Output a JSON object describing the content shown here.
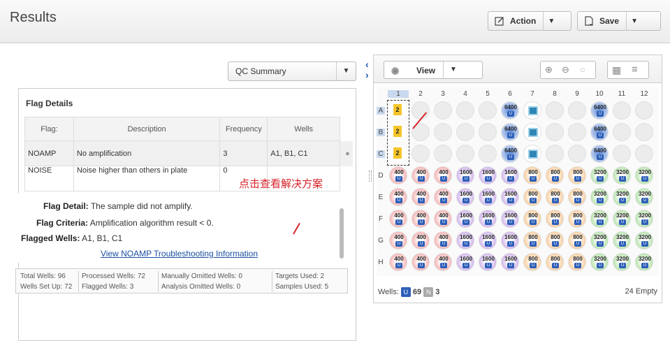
{
  "header": {
    "title": "Results",
    "action_label": "Action",
    "save_label": "Save"
  },
  "left": {
    "qc_select": "QC Summary",
    "flag_details_title": "Flag Details",
    "table": {
      "headers": [
        "Flag:",
        "Description",
        "Frequency",
        "Wells"
      ],
      "rows": [
        [
          "NOAMP",
          "No amplification",
          "3",
          "A1, B1, C1"
        ],
        [
          "NOISE",
          "Noise higher than others in plate",
          "0",
          ""
        ]
      ]
    },
    "detail": {
      "flag_detail_label": "Flag Detail:",
      "flag_detail_value": "The sample did not amplify.",
      "flag_criteria_label": "Flag Criteria:",
      "flag_criteria_value": "Amplification algorithm result < 0.",
      "flagged_wells_label": "Flagged Wells:",
      "flagged_wells_value": "A1, B1, C1",
      "link": "View NOAMP Troubleshooting Information"
    },
    "annotation": "点击查看解决方案",
    "stats": {
      "total_wells": "Total Wells:  96",
      "wells_set_up": "Wells Set Up: 72",
      "processed_wells": "Processed Wells: 72",
      "flagged_wells": "Flagged Wells:     3",
      "manually_omitted": "Manually Omitted Wells: 0",
      "analysis_omitted": "Analysis Omitted Wells: 0",
      "targets_used": "Targets Used:  2",
      "samples_used": "Samples Used: 5"
    }
  },
  "right": {
    "view_label": "View",
    "columns": [
      "1",
      "2",
      "3",
      "4",
      "5",
      "6",
      "7",
      "8",
      "9",
      "10",
      "11",
      "12"
    ],
    "rows": [
      "A",
      "B",
      "C",
      "D",
      "E",
      "F",
      "G",
      "H"
    ],
    "footer": {
      "wells_label": "Wells:",
      "u_count": "69",
      "n_count": "3",
      "empty": "24 Empty",
      "u_badge": "U",
      "n_badge": "N"
    }
  },
  "plate_values": {
    "top_rows": {
      "col6": "6400",
      "col10": "6400"
    },
    "bottom_rows": [
      "400",
      "400",
      "400",
      "1600",
      "1600",
      "1600",
      "800",
      "800",
      "800",
      "3200",
      "3200",
      "3200"
    ],
    "flag_value": "2",
    "unknown_badge": "U"
  },
  "colors": {
    "accent": "#2d5fb8",
    "annotation": "#d8232a",
    "flag": "#f5c52a",
    "link": "#1a4fa0"
  }
}
